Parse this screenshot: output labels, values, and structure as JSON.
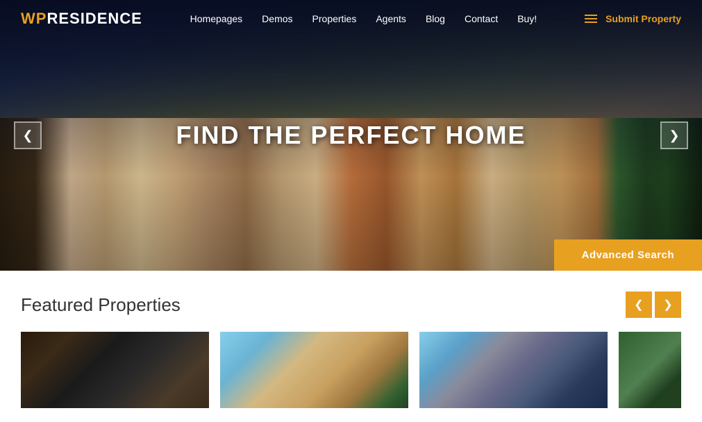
{
  "brand": {
    "wp": "WP",
    "residence": "RESIDENCE"
  },
  "header": {
    "submit_label": "Submit Property",
    "nav_items": [
      {
        "label": "Homepages",
        "href": "#"
      },
      {
        "label": "Demos",
        "href": "#"
      },
      {
        "label": "Properties",
        "href": "#"
      },
      {
        "label": "Agents",
        "href": "#"
      },
      {
        "label": "Blog",
        "href": "#"
      },
      {
        "label": "Contact",
        "href": "#"
      },
      {
        "label": "Buy!",
        "href": "#"
      }
    ]
  },
  "hero": {
    "title": "FIND THE PERFECT HOME",
    "advanced_search": "Advanced Search",
    "arrow_left": "❮",
    "arrow_right": "❯"
  },
  "featured": {
    "section_title": "Featured Properties",
    "nav_prev": "❮",
    "nav_next": "❯",
    "properties": [
      {
        "id": 1,
        "img_class": "card-img-1"
      },
      {
        "id": 2,
        "img_class": "card-img-2"
      },
      {
        "id": 3,
        "img_class": "card-img-3"
      },
      {
        "id": 4,
        "img_class": "card-img-4"
      }
    ]
  },
  "colors": {
    "accent": "#e8a020",
    "dark": "#1a1a2e",
    "white": "#ffffff"
  }
}
